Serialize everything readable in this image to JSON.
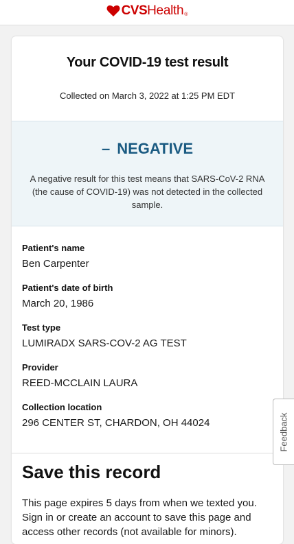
{
  "brand": {
    "logo_text_bold": "CVS",
    "logo_text_regular": "Health",
    "trademark": "®",
    "color": "#cc0000"
  },
  "result_card": {
    "title": "Your COVID-19 test result",
    "collected": "Collected on March 3, 2022 at 1:25  PM EDT",
    "result": {
      "dash": "–",
      "status": "NEGATIVE",
      "status_color": "#1b5b82",
      "description": "A negative result for this test means that SARS-CoV-2 RNA (the cause of COVID-19) was not detected in the collected sample."
    },
    "fields": [
      {
        "label": "Patient's name",
        "value": "Ben Carpenter"
      },
      {
        "label": "Patient's date of birth",
        "value": "March 20, 1986"
      },
      {
        "label": "Test type",
        "value": "LUMIRADX SARS-COV-2 AG TEST"
      },
      {
        "label": "Provider",
        "value": "REED-MCCLAIN LAURA"
      },
      {
        "label": "Collection location",
        "value": "296 CENTER ST, CHARDON, OH 44024"
      }
    ]
  },
  "save_record": {
    "title": "Save this record",
    "text": "This page expires 5 days from when we texted you. Sign in or create an account to save this page and access other records (not available for minors)."
  },
  "feedback": {
    "label": "Feedback"
  }
}
